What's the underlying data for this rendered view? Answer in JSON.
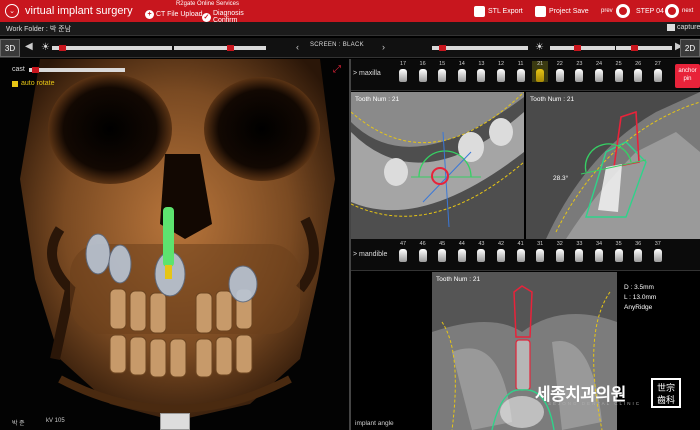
{
  "app": {
    "title": "virtual implant surgery",
    "logo_icon": "circle-chevron-icon"
  },
  "online_services": {
    "title": "R2gate Online Services",
    "ct_upload": "CT File Upload",
    "diagnosis_confirm": "Diagnosis Confirm"
  },
  "header_right": {
    "stl_export": "STL Export",
    "project_save": "Project Save",
    "prev": "prev",
    "step": "STEP 04",
    "next": "next",
    "capture": "capture"
  },
  "work_folder": {
    "label": "Work Folder : 박 준남"
  },
  "toolbar": {
    "mode_3d": "3D",
    "mode_2d": "2D",
    "screen_label": "SCREEN : BLACK",
    "sliders": [
      {
        "level": 0.06
      },
      {
        "level": 0.62
      },
      {
        "level": 0.08
      },
      {
        "level": 0.42
      },
      {
        "level": 0.3
      },
      {
        "level": 0.44
      }
    ]
  },
  "left_panel": {
    "cast_label": "cast",
    "auto_rotate": "auto rotate",
    "patient_name": "박 준",
    "kv": "kV 105",
    "cast_slider_level": 0.03
  },
  "maxilla": {
    "label": "> maxilla",
    "teeth": [
      "17",
      "16",
      "15",
      "14",
      "13",
      "12",
      "11",
      "21",
      "22",
      "23",
      "24",
      "25",
      "26",
      "27"
    ],
    "selected": "21",
    "anchor_pin": "anchor pin"
  },
  "mandible": {
    "label": "> mandible",
    "teeth": [
      "47",
      "46",
      "45",
      "44",
      "43",
      "42",
      "41",
      "31",
      "32",
      "33",
      "34",
      "35",
      "36",
      "37"
    ]
  },
  "views": {
    "axial_tooth": "Tooth Num : 21",
    "cross_tooth": "Tooth Num : 21",
    "angle": "28.3°",
    "pano_tooth": "Tooth Num : 21",
    "implant_d": "D : 3.5mm",
    "implant_l": "L : 13.0mm",
    "implant_brand": "AnyRidge",
    "implant_angle": "implant angle"
  },
  "watermark": {
    "clinic_ko": "세종치과의원",
    "seal": "世宗齒科",
    "sub": "SEJONG DENTAL CLINIC"
  },
  "colors": {
    "brand_red": "#c8161e",
    "accent_yellow": "#e6c515",
    "implant_green": "#2fd38a",
    "anchor_pink": "#e8233a"
  }
}
